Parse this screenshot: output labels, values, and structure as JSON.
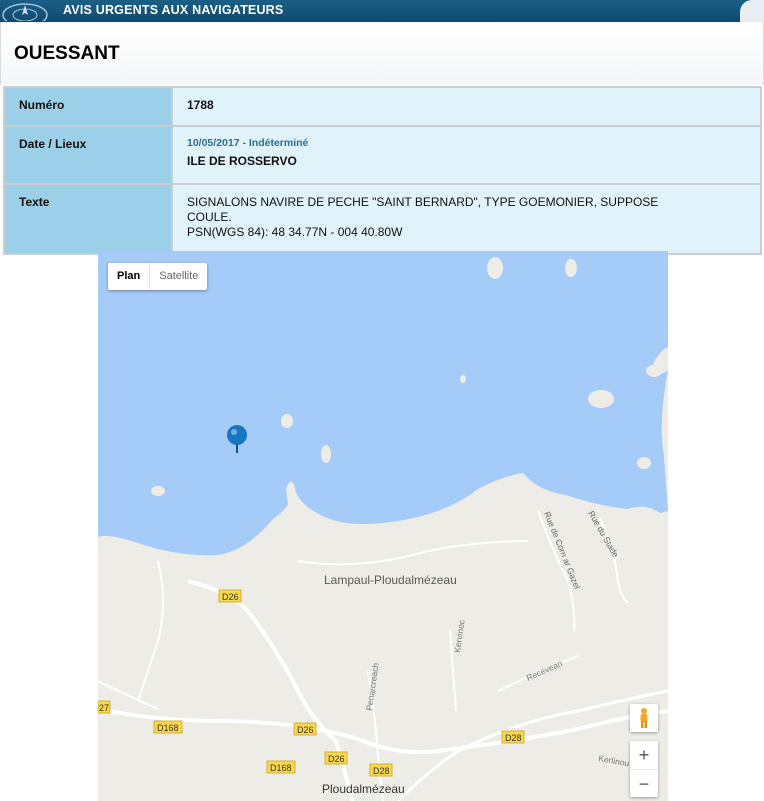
{
  "header": {
    "title": "AVIS URGENTS AUX NAVIGATEURS"
  },
  "page": {
    "title": "OUESSANT"
  },
  "notice": {
    "numero_label": "Numéro",
    "numero_value": "1788",
    "date_label": "Date / Lieux",
    "date_value": "10/05/2017 - Indéterminé",
    "lieu_value": "ILE DE ROSSERVO",
    "texte_label": "Texte",
    "texte_line1": "SIGNALONS NAVIRE DE PECHE \"SAINT BERNARD\", TYPE GOEMONIER, SUPPOSE",
    "texte_line2": "COULE.",
    "texte_line3": "PSN(WGS 84): 48 34.77N - 004 40.80W"
  },
  "map": {
    "type_plan": "Plan",
    "type_satellite": "Satellite",
    "zoom_in": "+",
    "zoom_out": "−",
    "place_lampaul": "Lampaul-Ploudalmézeau",
    "place_ploudalmezeau": "Ploudalmézeau",
    "road_d26a": "D26",
    "road_d26b": "D26",
    "road_d26c": "D26",
    "road_d168a": "D168",
    "road_d168b": "D168",
    "road_d28a": "D28",
    "road_d28b": "D28",
    "road_27": "27",
    "street_corn": "Rue de Corn ar Gazel",
    "street_stade": "Rue du Stade",
    "street_kervinoc": "Kervinoc",
    "street_penarcreach": "Penarcreach",
    "street_recevean": "Recevean",
    "street_kerlinou": "Kerlinou",
    "colors": {
      "water": "#a5cbf9",
      "land": "#eeece6",
      "road": "#ffffff",
      "shield": "#fad74a",
      "marker": "#1976c2"
    }
  }
}
